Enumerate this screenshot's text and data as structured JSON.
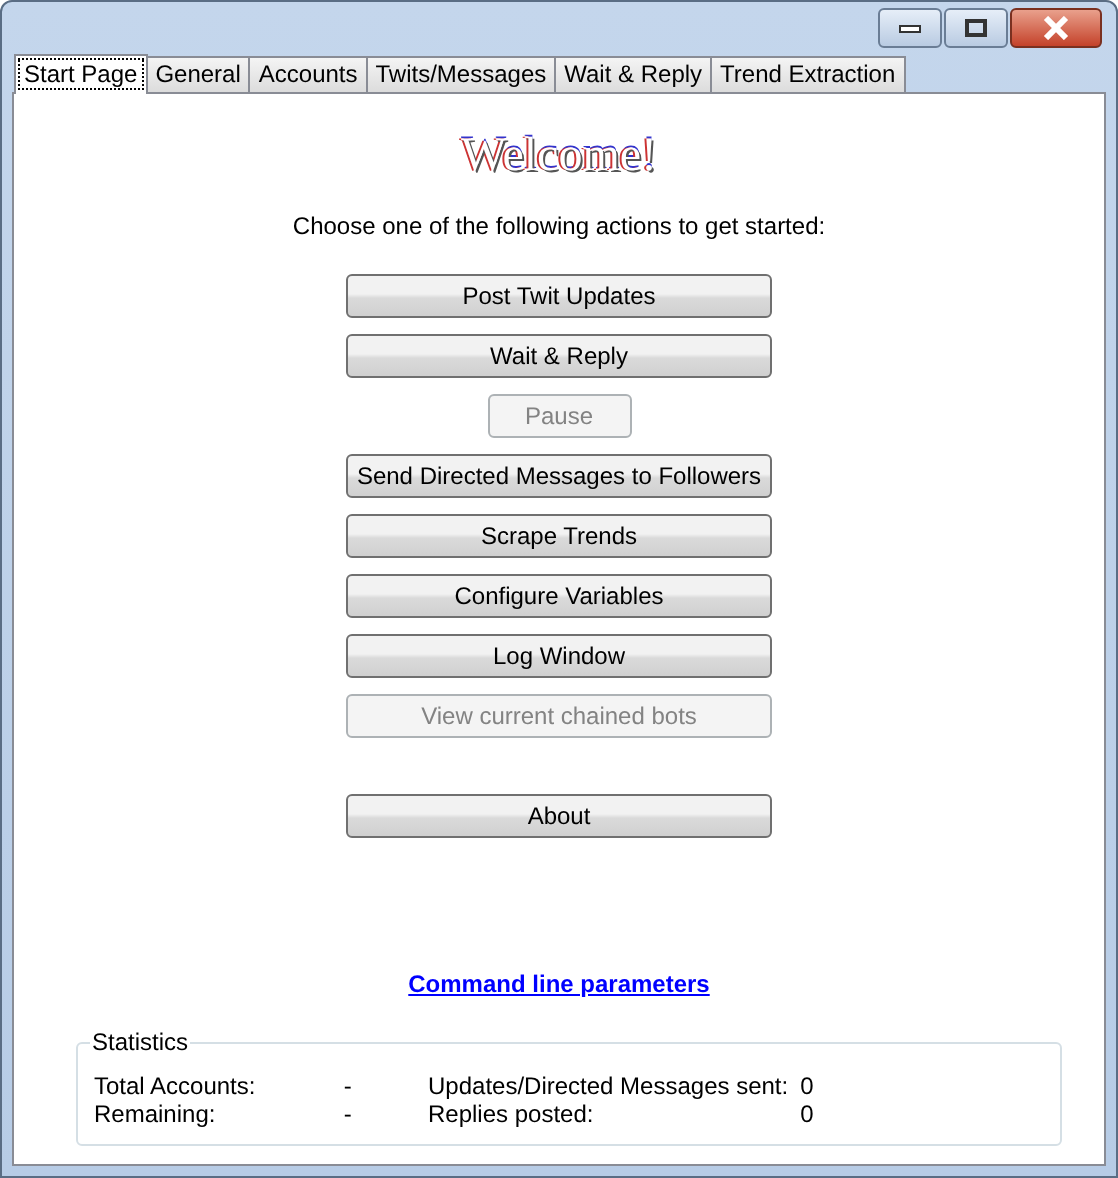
{
  "tabs": [
    {
      "label": "Start Page",
      "selected": true
    },
    {
      "label": "General",
      "selected": false
    },
    {
      "label": "Accounts",
      "selected": false
    },
    {
      "label": "Twits/Messages",
      "selected": false
    },
    {
      "label": "Wait & Reply",
      "selected": false
    },
    {
      "label": "Trend Extraction",
      "selected": false
    }
  ],
  "heading": "Welcome!",
  "instruction": "Choose one of the following actions to get started:",
  "actions": [
    {
      "label": "Post Twit Updates",
      "kind": "wide",
      "disabled": false
    },
    {
      "label": "Wait & Reply",
      "kind": "wide",
      "disabled": false
    },
    {
      "label": "Pause",
      "kind": "small",
      "disabled": true
    },
    {
      "label": "Send Directed Messages to Followers",
      "kind": "wide",
      "disabled": false
    },
    {
      "label": "Scrape Trends",
      "kind": "wide",
      "disabled": false
    },
    {
      "label": "Configure Variables",
      "kind": "wide",
      "disabled": false
    },
    {
      "label": "Log Window",
      "kind": "wide",
      "disabled": false
    },
    {
      "label": "View current chained bots",
      "kind": "wide",
      "disabled": true
    }
  ],
  "about_button": {
    "label": "About",
    "disabled": false
  },
  "link": "Command line parameters",
  "statistics": {
    "title": "Statistics",
    "left": [
      {
        "label": "Total Accounts:",
        "value": "-"
      },
      {
        "label": "Remaining:",
        "value": "-"
      }
    ],
    "right": [
      {
        "label": "Updates/Directed Messages sent:",
        "value": "0"
      },
      {
        "label": "Replies posted:",
        "value": "0"
      }
    ]
  }
}
